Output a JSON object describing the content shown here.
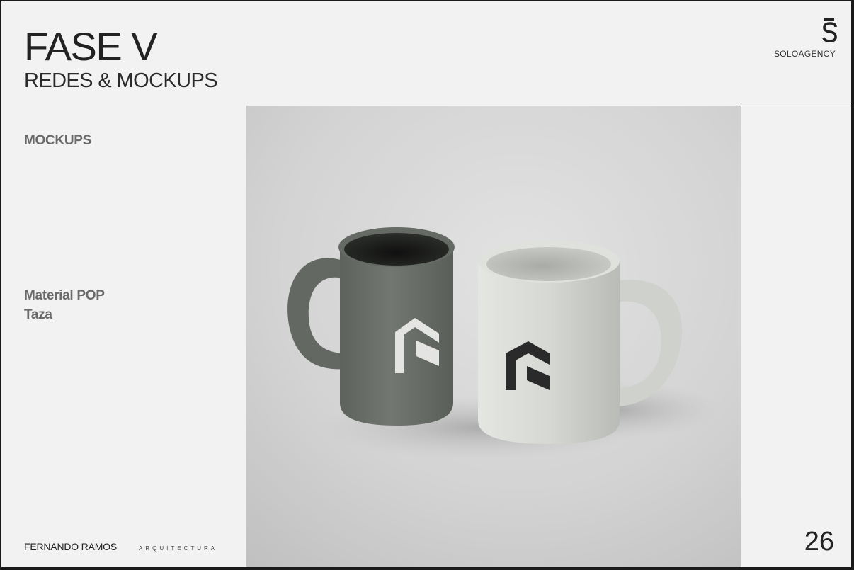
{
  "header": {
    "title": "FASE V",
    "subtitle": "REDES & MOCKUPS"
  },
  "brand": {
    "mark_icon": "solo-s-logo-icon",
    "name": "SOLOAGENCY"
  },
  "sidebar": {
    "section_label": "MOCKUPS",
    "description_lines": [
      "Material POP",
      "Taza"
    ]
  },
  "photo": {
    "subject": "mug-pair-mockup",
    "left_mug_color": "#6f736e",
    "right_mug_color": "#d9dbd7",
    "background_color": "#d2d2d2"
  },
  "footer": {
    "name": "FERNANDO RAMOS",
    "subtitle": "ARQUITECTURA",
    "page_number": "26"
  }
}
